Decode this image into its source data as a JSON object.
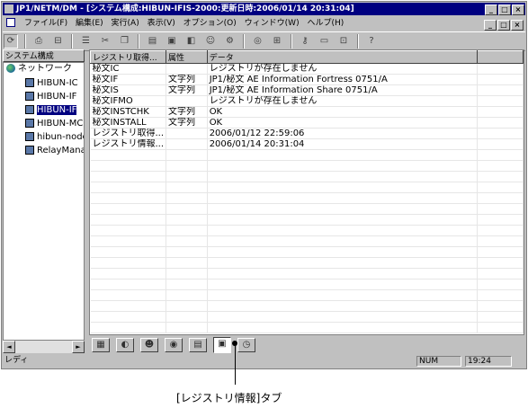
{
  "window": {
    "title": "JP1/NETM/DM - [システム構成:HIBUN-IFIS-2000:更新日時:2006/01/14 20:31:04]",
    "title_buttons": [
      "_",
      "□",
      "×"
    ],
    "mdi_buttons": [
      "_",
      "□",
      "×"
    ]
  },
  "menu": [
    "ファイル(F)",
    "編集(E)",
    "実行(A)",
    "表示(V)",
    "オプション(O)",
    "ウィンドウ(W)",
    "ヘルプ(H)"
  ],
  "toolbar": {
    "icons": [
      "refresh-icon",
      "print-icon",
      "print-preview-icon",
      "list-icon",
      "cut-icon",
      "copy-icon",
      "paste-icon",
      "delete-icon",
      "properties-icon",
      "user-icon",
      "settings-icon",
      "target-icon",
      "network-icon",
      "key-icon",
      "window-icon",
      "tile-icon",
      "help-icon"
    ]
  },
  "left_pane": {
    "header": "システム構成",
    "nodes": [
      {
        "label": "ネットワーク",
        "type": "network",
        "selected": false
      },
      {
        "label": "HIBUN-IC",
        "type": "pc",
        "selected": false
      },
      {
        "label": "HIBUN-IF",
        "type": "pc",
        "selected": false
      },
      {
        "label": "HIBUN-IF",
        "type": "pc",
        "selected": true
      },
      {
        "label": "HIBUN-MC",
        "type": "pc",
        "selected": false
      },
      {
        "label": "hibun-nodes",
        "type": "pc",
        "selected": false
      },
      {
        "label": "RelayManager",
        "type": "pc",
        "selected": false
      }
    ],
    "scroll_left": "◄",
    "scroll_right": "►"
  },
  "grid": {
    "columns": [
      "レジストリ取得...",
      "属性",
      "データ"
    ],
    "rows": [
      [
        "秘文IC",
        "",
        "レジストリが存在しません"
      ],
      [
        "秘文IF",
        "文字列",
        "JP1/秘文 AE Information Fortress 0751/A"
      ],
      [
        "秘文IS",
        "文字列",
        "JP1/秘文 AE Information Share 0751/A"
      ],
      [
        "秘文IFMO",
        "",
        "レジストリが存在しません"
      ],
      [
        "秘文INSTCHK",
        "文字列",
        "OK"
      ],
      [
        "秘文INSTALL",
        "文字列",
        "OK"
      ],
      [
        "レジストリ取得...",
        "",
        "2006/01/12 22:59:06"
      ],
      [
        "レジストリ情報...",
        "",
        "2006/01/14 20:31:04"
      ]
    ],
    "empty_rows": 17
  },
  "tabs": [
    {
      "icon": "hardware-tab-icon",
      "glyph": "▦",
      "active": false
    },
    {
      "icon": "software-tab-icon",
      "glyph": "◐",
      "active": false
    },
    {
      "icon": "user-info-tab-icon",
      "glyph": "☻",
      "active": false
    },
    {
      "icon": "network-tab-icon",
      "glyph": "◉",
      "active": false
    },
    {
      "icon": "document-tab-icon",
      "glyph": "▤",
      "active": false
    },
    {
      "icon": "registry-tab-icon",
      "glyph": "▣",
      "active": true
    },
    {
      "icon": "history-tab-icon",
      "glyph": "◷",
      "active": false
    }
  ],
  "status": {
    "ready": "レディ",
    "num": "NUM",
    "time": "19:24"
  },
  "callout": "[レジストリ情報]タブ"
}
